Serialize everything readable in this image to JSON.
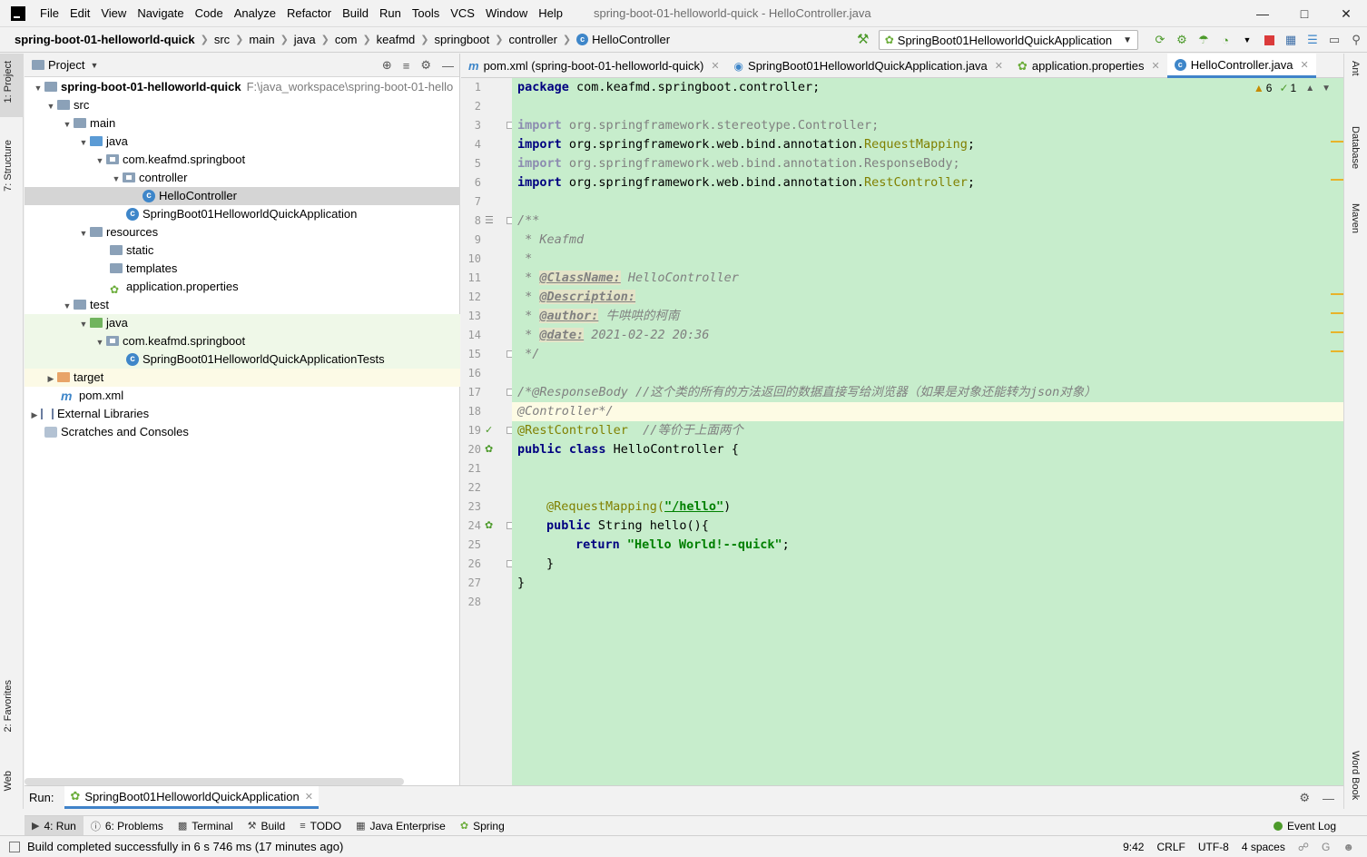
{
  "menu": {
    "items": [
      "File",
      "Edit",
      "View",
      "Navigate",
      "Code",
      "Analyze",
      "Refactor",
      "Build",
      "Run",
      "Tools",
      "VCS",
      "Window",
      "Help"
    ],
    "underline": [
      "F",
      "E",
      "V",
      "N",
      "C",
      "z",
      "R",
      "B",
      "u",
      "T",
      "S",
      "W",
      "H"
    ],
    "window_title": "spring-boot-01-helloworld-quick - HelloController.java"
  },
  "navbar": {
    "crumbs": [
      "spring-boot-01-helloworld-quick",
      "src",
      "main",
      "java",
      "com",
      "keafmd",
      "springboot",
      "controller",
      "HelloController"
    ],
    "run_config": "SpringBoot01HelloworldQuickApplication"
  },
  "left_strip": {
    "project": "1: Project",
    "structure": "7: Structure",
    "favorites": "2: Favorites",
    "web": "Web"
  },
  "right_strip": {
    "ant": "Ant",
    "database": "Database",
    "maven": "Maven",
    "word_book": "Word Book"
  },
  "project_panel": {
    "title": "Project",
    "tree": [
      {
        "label": "spring-boot-01-helloworld-quick",
        "hint": "F:\\java_workspace\\spring-boot-01-hello"
      },
      {
        "label": "src"
      },
      {
        "label": "main"
      },
      {
        "label": "java"
      },
      {
        "label": "com.keafmd.springboot"
      },
      {
        "label": "controller"
      },
      {
        "label": "HelloController"
      },
      {
        "label": "SpringBoot01HelloworldQuickApplication"
      },
      {
        "label": "resources"
      },
      {
        "label": "static"
      },
      {
        "label": "templates"
      },
      {
        "label": "application.properties"
      },
      {
        "label": "test"
      },
      {
        "label": "java"
      },
      {
        "label": "com.keafmd.springboot"
      },
      {
        "label": "SpringBoot01HelloworldQuickApplicationTests"
      },
      {
        "label": "target"
      },
      {
        "label": "pom.xml"
      },
      {
        "label": "External Libraries"
      },
      {
        "label": "Scratches and Consoles"
      }
    ]
  },
  "editor": {
    "tabs": [
      {
        "label": "pom.xml (spring-boot-01-helloworld-quick)"
      },
      {
        "label": "SpringBoot01HelloworldQuickApplication.java"
      },
      {
        "label": "application.properties"
      },
      {
        "label": "HelloController.java"
      }
    ],
    "warnings": "6",
    "weak_warnings": "1",
    "line_numbers": [
      "1",
      "2",
      "3",
      "4",
      "5",
      "6",
      "7",
      "8",
      "9",
      "10",
      "11",
      "12",
      "13",
      "14",
      "15",
      "16",
      "17",
      "18",
      "19",
      "20",
      "21",
      "22",
      "23",
      "24",
      "25",
      "26",
      "27",
      "28"
    ],
    "code": {
      "l1_kw": "package",
      "l1_rest": " com.keafmd.springboot.controller;",
      "l3_kw": "import",
      "l3_rest": " org.springframework.stereotype.Controller;",
      "l4_kw": "import",
      "l4_rest": " org.springframework.web.bind.annotation.",
      "l4_ann": "RequestMapping",
      "l4_end": ";",
      "l5_kw": "import",
      "l5_rest": " org.springframework.web.bind.annotation.ResponseBody;",
      "l6_kw": "import",
      "l6_rest": " org.springframework.web.bind.annotation.",
      "l6_ann": "RestController",
      "l6_end": ";",
      "l8": "/**",
      "l9": " * Keafmd",
      "l10": " *",
      "l11_pre": " * ",
      "l11_tag": "@ClassName:",
      "l11_rest": " HelloController",
      "l12_pre": " * ",
      "l12_tag": "@Description:",
      "l13_pre": " * ",
      "l13_tag": "@author:",
      "l13_rest": " 牛哄哄的柯南",
      "l14_pre": " * ",
      "l14_tag": "@date:",
      "l14_rest": " 2021-02-22 20:36",
      "l15": " */",
      "l17": "/*@ResponseBody //这个类的所有的方法返回的数据直接写给浏览器（如果是对象还能转为json对象）",
      "l18": "@Controller*/",
      "l19_ann": "@RestController",
      "l19_cmt": "  //等价于上面两个",
      "l20_kw": "public class",
      "l20_rest": " HelloController {",
      "l23_ann": "@RequestMapping(",
      "l23_str": "\"/hello\"",
      "l23_end": ")",
      "l24_kw": "public",
      "l24_rest": " String hello(){",
      "l25_kw": "return",
      "l25_str": "\"Hello World!--quick\"",
      "l25_end": ";",
      "l26": "}",
      "l27": "}"
    }
  },
  "run_bar": {
    "label": "Run:",
    "tab": "SpringBoot01HelloworldQuickApplication"
  },
  "tool_bar": {
    "items": [
      "4: Run",
      "6: Problems",
      "Terminal",
      "Build",
      "TODO",
      "Java Enterprise",
      "Spring"
    ],
    "event_log": "Event Log"
  },
  "status": {
    "message": "Build completed successfully in 6 s 746 ms (17 minutes ago)",
    "position": "9:42",
    "line_sep": "CRLF",
    "encoding": "UTF-8",
    "indent": "4 spaces"
  }
}
